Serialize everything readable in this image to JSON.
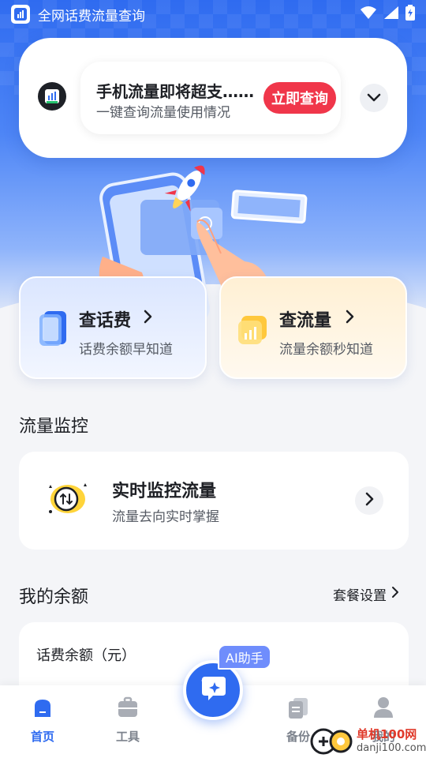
{
  "status_bar": {
    "app_title": "全网话费流量查询",
    "signal_icon": "wifi-icon",
    "cell_icon": "signal-icon",
    "battery_icon": "battery-charging-icon"
  },
  "notice": {
    "title": "手机流量即将超支……",
    "subtitle": "一键查询流量使用情况",
    "button_label": "立即查询",
    "expand_icon": "chevron-down-icon"
  },
  "query_cards": [
    {
      "title": "查话费",
      "subtitle": "话费余额早知道",
      "icon": "phone-card-icon"
    },
    {
      "title": "查流量",
      "subtitle": "流量余额秒知道",
      "icon": "data-card-icon"
    }
  ],
  "monitor_section": {
    "heading": "流量监控",
    "title": "实时监控流量",
    "subtitle": "流量去向实时掌握"
  },
  "balance_section": {
    "heading": "我的余额",
    "plan_link": "套餐设置",
    "card_label": "话费余额（元）"
  },
  "bottom_nav": {
    "items": [
      {
        "label": "首页",
        "icon": "home-icon",
        "active": true
      },
      {
        "label": "工具",
        "icon": "toolbox-icon",
        "active": false
      },
      {
        "label": "备份",
        "icon": "backup-icon",
        "active": false
      },
      {
        "label": "我的",
        "icon": "user-icon",
        "active": false
      }
    ],
    "ai_label": "AI助手"
  },
  "watermark": {
    "cn": "单机100网",
    "url": "danji100.com"
  },
  "colors": {
    "primary": "#2f6bf0",
    "accent_red": "#f0364a",
    "text": "#1d1f24",
    "muted": "#555a63"
  }
}
